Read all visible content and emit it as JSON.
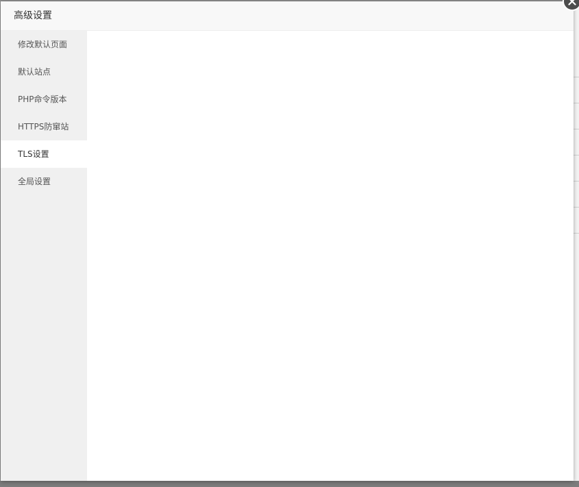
{
  "dialog": {
    "title": "高级设置",
    "close_icon": "close-icon"
  },
  "sidebar": {
    "items": [
      {
        "label": "修改默认页面",
        "active": false
      },
      {
        "label": "默认站点",
        "active": false
      },
      {
        "label": "PHP命令版本",
        "active": false
      },
      {
        "label": "HTTPS防窜站",
        "active": false
      },
      {
        "label": "TLS设置",
        "active": true
      },
      {
        "label": "全局设置",
        "active": false
      }
    ]
  },
  "colors": {
    "sidebar_bg": "#f0f0f0",
    "active_item_bg": "#ffffff",
    "overlay": "#8f8f8f"
  }
}
